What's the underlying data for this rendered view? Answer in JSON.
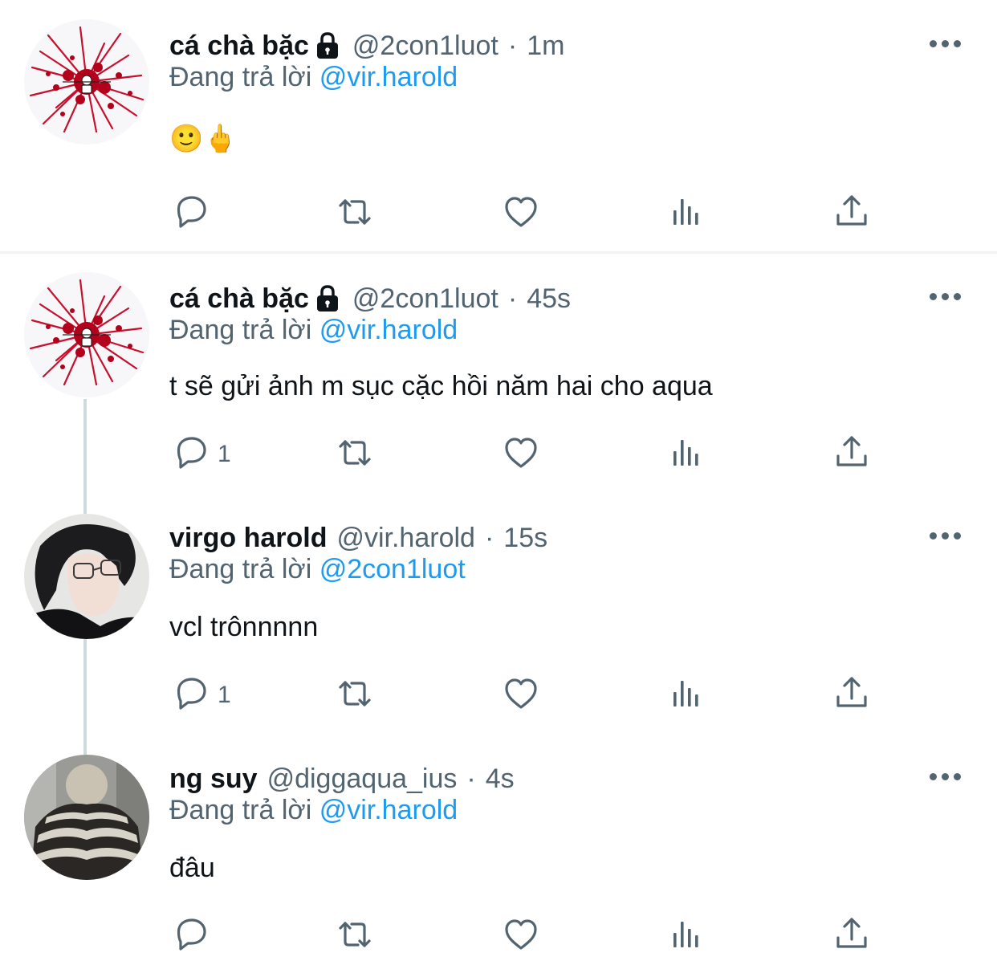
{
  "reply_prefix": "Đang trả lời",
  "colors": {
    "accent": "#1d9bf0",
    "secondary_text": "#536471",
    "divider": "#eff3f4",
    "thread_line": "#cfd9de"
  },
  "icons": {
    "reply": "speech-bubble-icon",
    "retweet": "retweet-icon",
    "like": "heart-icon",
    "views": "bar-chart-icon",
    "share": "share-icon",
    "more": "more-dots-icon",
    "lock": "lock-icon"
  },
  "tweets": [
    {
      "name": "cá chà bặc",
      "protected": true,
      "handle": "@2con1luot",
      "sep": "·",
      "time": "1m",
      "reply_to": "@vir.harold",
      "text": "🙂🖕",
      "reply_count": "",
      "avatar": "splatter-avatar"
    },
    {
      "name": "cá chà bặc",
      "protected": true,
      "handle": "@2con1luot",
      "sep": "·",
      "time": "45s",
      "reply_to": "@vir.harold",
      "text": "t sẽ gửi ảnh m sục cặc hồi năm hai cho aqua",
      "reply_count": "1",
      "avatar": "splatter-avatar"
    },
    {
      "name": "virgo harold",
      "protected": false,
      "handle": "@vir.harold",
      "sep": "·",
      "time": "15s",
      "reply_to": "@2con1luot",
      "text": "vcl trônnnnn",
      "reply_count": "1",
      "avatar": "person-glasses-avatar"
    },
    {
      "name": "ng suy",
      "protected": false,
      "handle": "@diggaqua_ius",
      "sep": "·",
      "time": "4s",
      "reply_to": "@vir.harold",
      "text": "đâu",
      "reply_count": "",
      "avatar": "person-striped-sweater-avatar"
    }
  ]
}
